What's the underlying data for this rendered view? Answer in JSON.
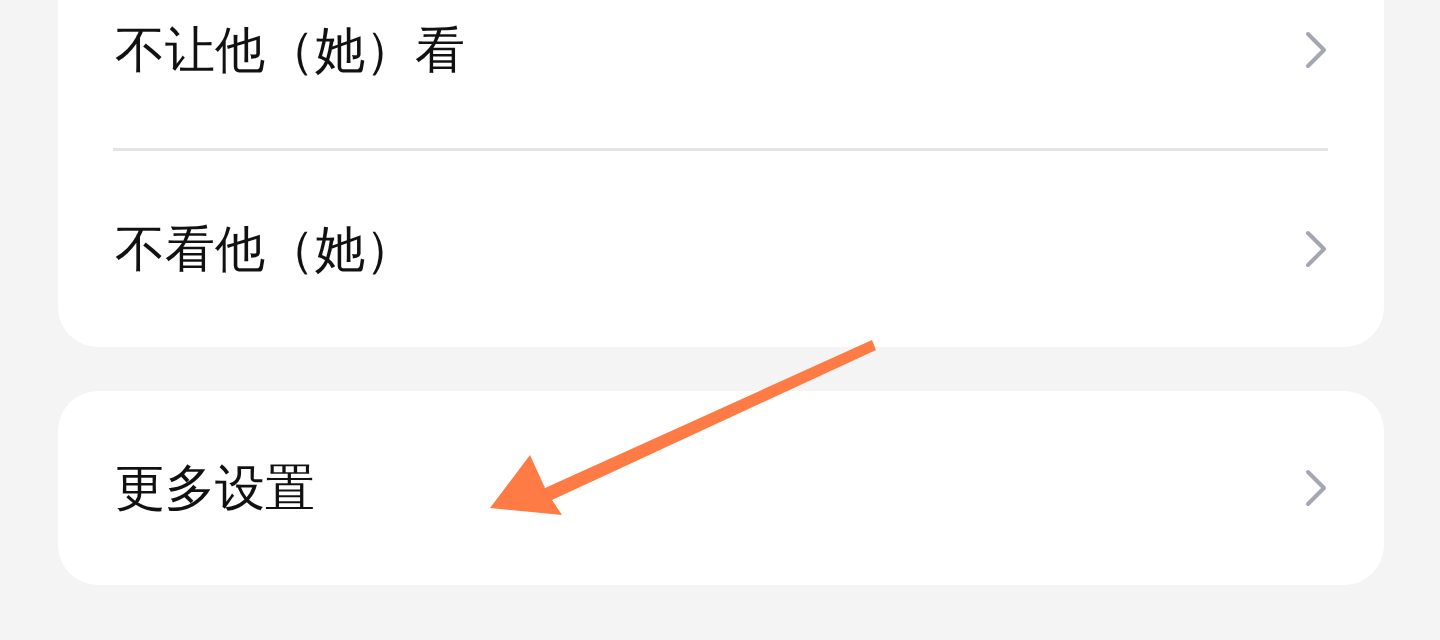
{
  "sections": [
    {
      "items": [
        {
          "label": "不让他（她）看"
        },
        {
          "label": "不看他（她）"
        }
      ]
    },
    {
      "items": [
        {
          "label": "更多设置"
        }
      ]
    }
  ],
  "arrow_annotation": true
}
